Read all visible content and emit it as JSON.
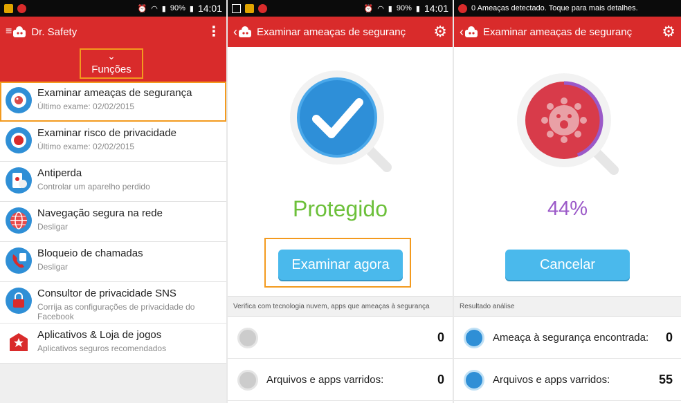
{
  "status_left": {
    "battery": "90%",
    "time": "14:01"
  },
  "status_middle": {
    "battery": "90%",
    "time": "14:01"
  },
  "status_right": {
    "notification": "0 Ameaças detectado. Toque para mais detalhes."
  },
  "panel_menu": {
    "title": "Dr. Safety",
    "section_label": "Funções",
    "items": [
      {
        "title": "Examinar ameaças de segurança",
        "subtitle": "Último exame: 02/02/2015",
        "icon": "virus-scan-icon",
        "color": "#2f8fd6"
      },
      {
        "title": "Examinar risco de privacidade",
        "subtitle": "Último exame: 02/02/2015",
        "icon": "privacy-icon",
        "color": "#2f8fd6"
      },
      {
        "title": "Antiperda",
        "subtitle": "Controlar um aparelho perdido",
        "icon": "antitheft-icon",
        "color": "#2f8fd6"
      },
      {
        "title": "Navegação segura na rede",
        "subtitle": "Desligar",
        "icon": "globe-icon",
        "color": "#2f8fd6"
      },
      {
        "title": "Bloqueio de chamadas",
        "subtitle": "Desligar",
        "icon": "call-block-icon",
        "color": "#2f8fd6"
      },
      {
        "title": "Consultor de privacidade SNS",
        "subtitle": "Corrija as configurações de privacidade do Facebook",
        "icon": "lock-icon",
        "color": "#2f8fd6"
      },
      {
        "title": "Aplicativos & Loja de jogos",
        "subtitle": "Aplicativos seguros recomendados",
        "icon": "store-icon",
        "color": "#d92b2b"
      }
    ]
  },
  "panel_scan_done": {
    "title": "Examinar ameaças de seguranç",
    "status_text": "Protegido",
    "button_label": "Examinar agora",
    "caption": "Verifica com tecnologia nuvem, apps que ameaças à segurança",
    "rows": [
      {
        "label": "",
        "value": "0",
        "icon": "shield-scan-icon"
      },
      {
        "label": "Arquivos e apps varridos:",
        "value": "0",
        "icon": "files-icon"
      }
    ]
  },
  "panel_scanning": {
    "title": "Examinar ameaças de seguranç",
    "progress_text": "44%",
    "progress": 0.44,
    "button_label": "Cancelar",
    "caption": "Resultado análise",
    "rows": [
      {
        "label": "Ameaça à segurança encontrada:",
        "value": "0",
        "icon": "virus-icon"
      },
      {
        "label": "Arquivos e apps varridos:",
        "value": "55",
        "icon": "files-scan-icon"
      }
    ]
  },
  "colors": {
    "brand_red": "#d92b2b",
    "accent_blue": "#4ab9ec",
    "protected_green": "#6cc03a",
    "progress_purple": "#9b59c8",
    "highlight_orange": "#f39a1e"
  }
}
